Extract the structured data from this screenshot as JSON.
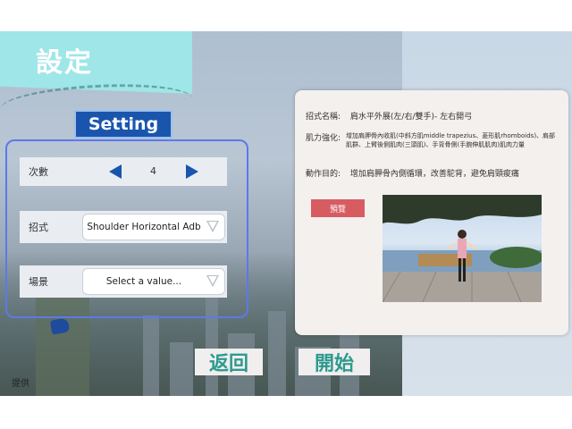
{
  "header": {
    "title": "設定"
  },
  "settings_panel": {
    "heading_button": "Setting",
    "rows": [
      {
        "label": "次數",
        "value": "4"
      },
      {
        "label": "招式",
        "value": "Shoulder Horizontal Adb"
      },
      {
        "label": "場景",
        "value": "Select a value..."
      }
    ]
  },
  "info_card": {
    "name_key": "招式名稱:",
    "name_value": "肩水平外展(左/右/雙手)- 左右開弓",
    "muscle_key": "肌力強化:",
    "muscle_value": "增加肩胛骨內收肌(中斜方肌middle trapezius、菱形肌rhomboids)、肩部肌群、上臂後側肌肉(三頭肌)、手背骨側(手腕伸肌肌肉)肌肉力量",
    "purpose_key": "動作目的:",
    "purpose_value": "增加肩胛骨內側循環，改善駝背，避免肩頸痠痛",
    "preview_button": "預覽"
  },
  "footer": {
    "back_button": "返回",
    "start_button": "開始",
    "credit": "提供"
  },
  "colors": {
    "accent_blue": "#1a55ad",
    "header_teal": "#9fe6e8",
    "preview_red": "#d75c62",
    "footer_text_teal": "#2d9a8e"
  },
  "icons": [
    "left-arrow-icon",
    "right-arrow-icon",
    "dropdown-caret-icon",
    "app-logo-icon"
  ]
}
